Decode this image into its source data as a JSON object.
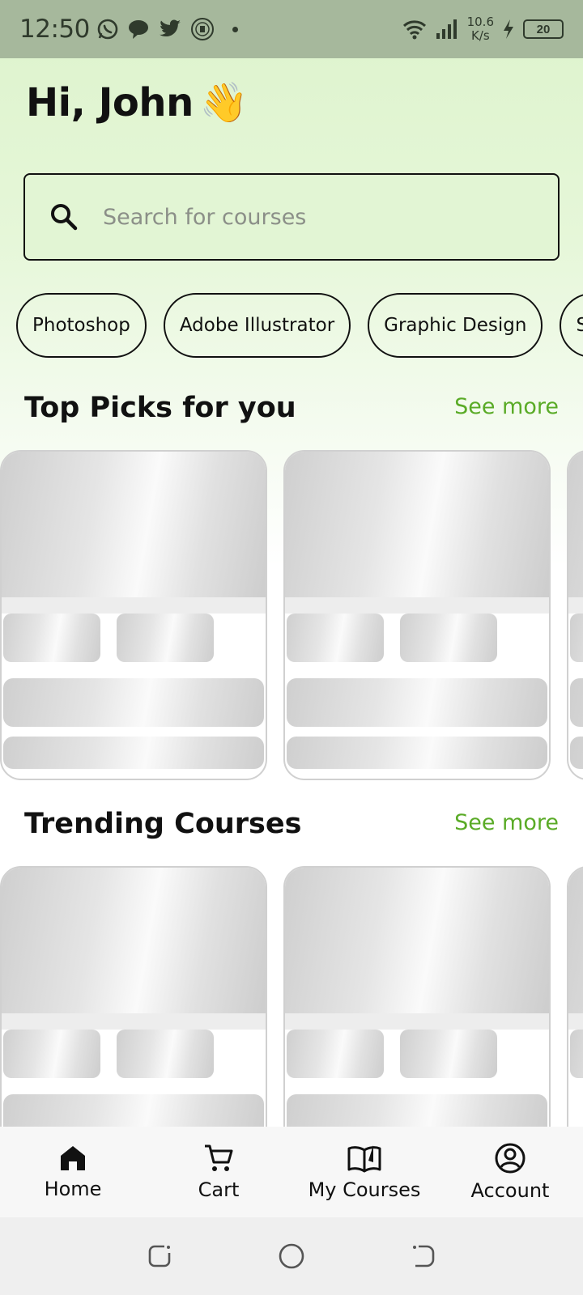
{
  "status_bar": {
    "time": "12:50",
    "net_speed_value": "10.6",
    "net_speed_unit": "K/s",
    "battery": "20",
    "icons": [
      "whatsapp-icon",
      "chat-bubble-icon",
      "twitter-icon",
      "club-crest-icon",
      "dot-icon",
      "wifi-icon",
      "signal-icon",
      "charging-icon",
      "battery-icon"
    ]
  },
  "header": {
    "greeting": "Hi, John",
    "wave_emoji": "👋"
  },
  "search": {
    "placeholder": "Search for courses",
    "value": ""
  },
  "categories": [
    {
      "label": "Photoshop"
    },
    {
      "label": "Adobe Illustrator"
    },
    {
      "label": "Graphic Design"
    },
    {
      "label": "Sketch"
    }
  ],
  "sections": {
    "top_picks": {
      "title": "Top Picks for you",
      "see_more": "See more"
    },
    "trending": {
      "title": "Trending Courses",
      "see_more": "See more"
    }
  },
  "bottom_nav": {
    "items": [
      {
        "label": "Home",
        "icon": "home-icon",
        "active": true
      },
      {
        "label": "Cart",
        "icon": "cart-icon",
        "active": false
      },
      {
        "label": "My Courses",
        "icon": "book-icon",
        "active": false
      },
      {
        "label": "Account",
        "icon": "account-icon",
        "active": false
      }
    ]
  },
  "colors": {
    "accent": "#5aab27",
    "status_bar": "#a6b89c",
    "search_bg": "#e2f5d4",
    "gradient_top": "#ddf3cc"
  }
}
